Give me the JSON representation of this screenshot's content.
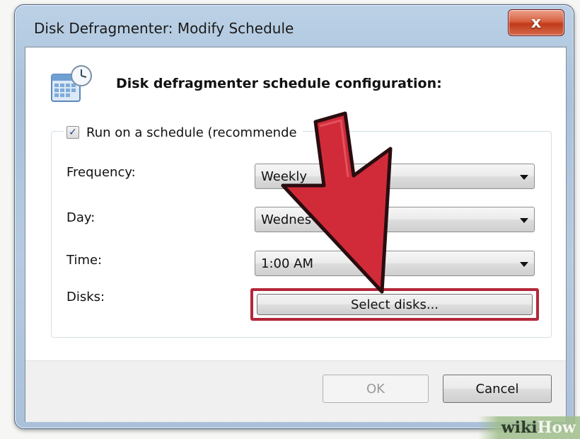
{
  "window": {
    "title": "Disk Defragmenter: Modify Schedule",
    "close_label": "x"
  },
  "header": {
    "title": "Disk defragmenter schedule configuration:",
    "icon": "calendar-clock-icon"
  },
  "schedule": {
    "run_on_schedule_label": "Run on a schedule (recommende",
    "run_on_schedule_checked": true,
    "check_glyph": "✓"
  },
  "fields": {
    "frequency": {
      "label": "Frequency:",
      "value": "Weekly"
    },
    "day": {
      "label": "Day:",
      "value": "Wednes"
    },
    "time": {
      "label": "Time:",
      "value": "1:00 AM"
    },
    "disks": {
      "label": "Disks:",
      "button_label": "Select disks..."
    }
  },
  "buttons": {
    "ok_label": "OK",
    "ok_enabled": false,
    "cancel_label": "Cancel"
  },
  "annotation": {
    "arrow_color": "#d12b3a",
    "highlight_color": "#b3273a"
  },
  "watermark": {
    "part1": "wiki",
    "part2": "How"
  }
}
